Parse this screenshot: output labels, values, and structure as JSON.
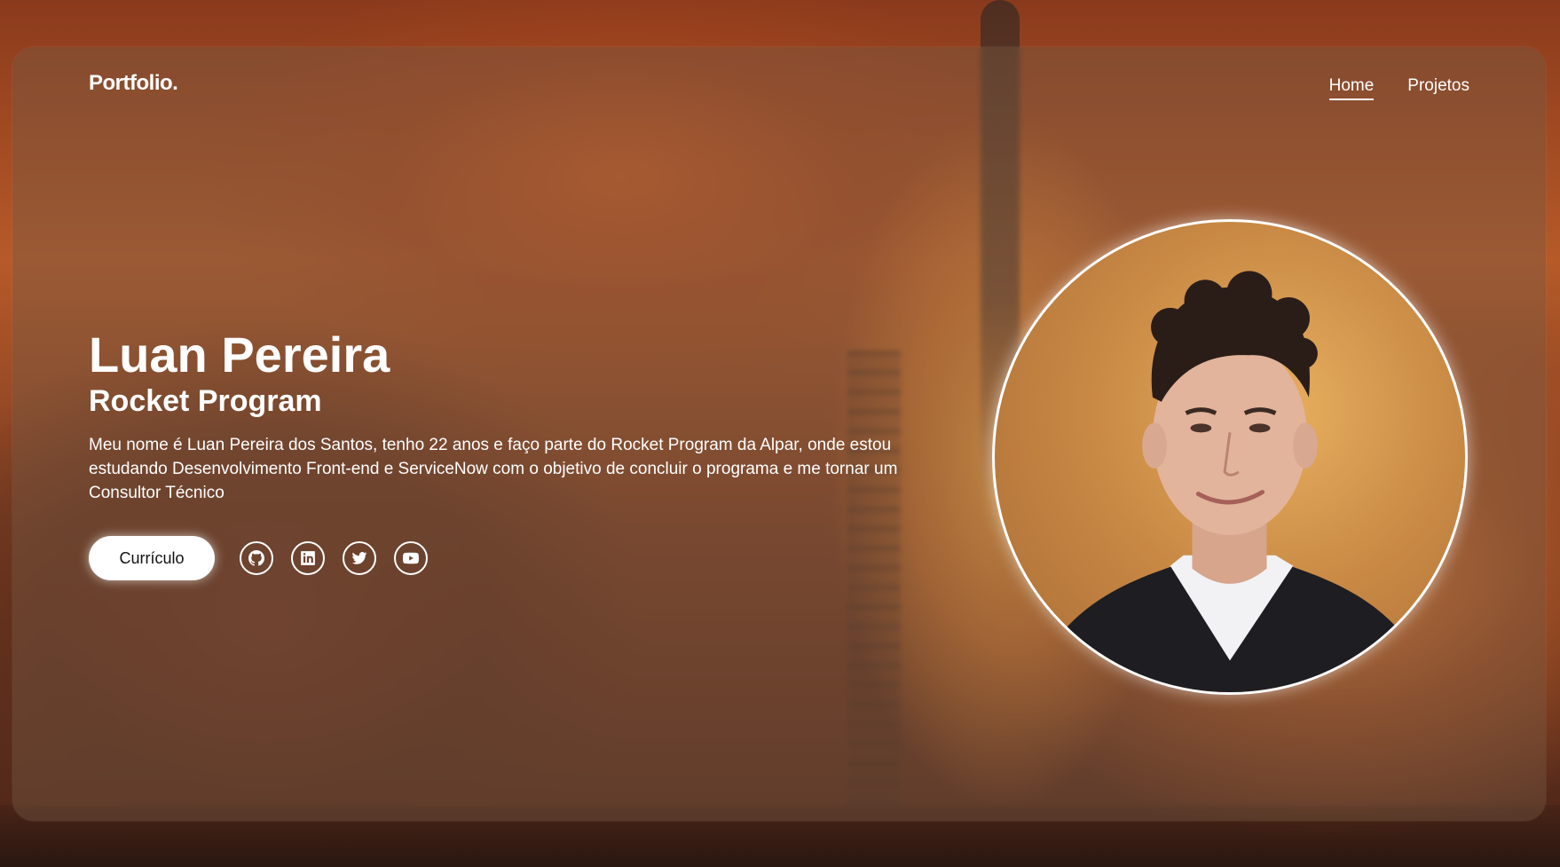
{
  "brand": "Portfolio.",
  "nav": {
    "items": [
      {
        "label": "Home",
        "active": true
      },
      {
        "label": "Projetos",
        "active": false
      }
    ]
  },
  "hero": {
    "name": "Luan Pereira",
    "subtitle": "Rocket Program",
    "bio": "Meu nome é Luan Pereira dos Santos, tenho 22 anos e faço parte do Rocket Program da Alpar, onde estou estudando Desenvolvimento Front-end e ServiceNow com o objetivo de concluir o programa e me tornar um Consultor Técnico"
  },
  "actions": {
    "cv_label": "Currículo",
    "social": [
      {
        "icon": "github-icon"
      },
      {
        "icon": "linkedin-icon"
      },
      {
        "icon": "twitter-icon"
      },
      {
        "icon": "youtube-icon"
      }
    ]
  },
  "colors": {
    "accent": "#ffffff",
    "card_overlay": "#785a46"
  }
}
